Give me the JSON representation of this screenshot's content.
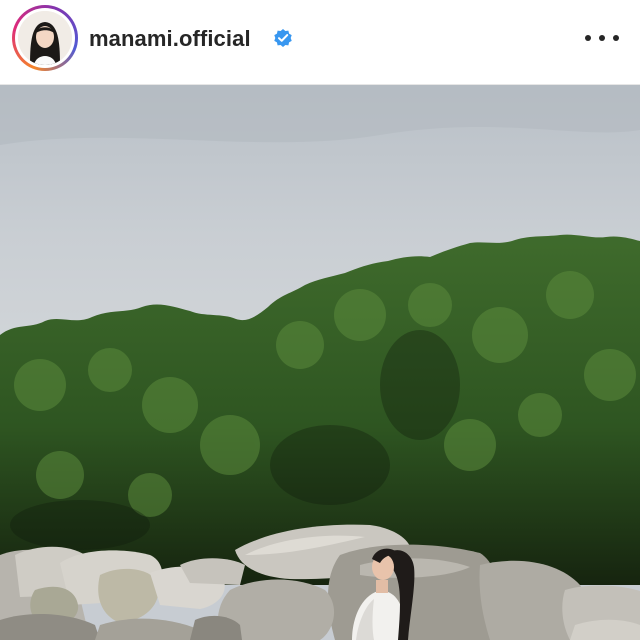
{
  "header": {
    "username": "manami.official",
    "verified": true,
    "avatar_icon": "profile-avatar",
    "verified_icon": "verified-badge-icon",
    "more_icon": "more-options-icon",
    "colors": {
      "verified_blue": "#3897f0",
      "ring_gradient": [
        "#f58529",
        "#dd2a7b",
        "#8134af",
        "#515bd4"
      ],
      "text": "#262626"
    }
  },
  "post": {
    "media_type": "photo"
  }
}
